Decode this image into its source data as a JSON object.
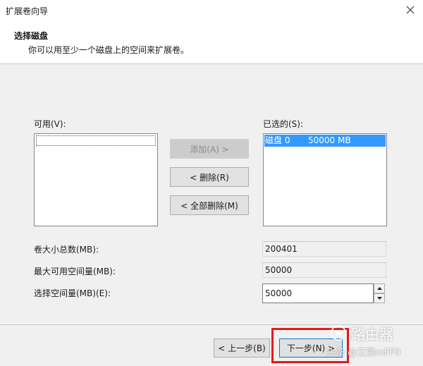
{
  "window": {
    "title": "扩展卷向导"
  },
  "header": {
    "title": "选择磁盘",
    "subtitle": "你可以用至少一个磁盘上的空间来扩展卷。"
  },
  "available": {
    "label": "可用(V):",
    "items": []
  },
  "selected": {
    "label": "已选的(S):",
    "items": [
      {
        "name": "磁盘 0",
        "size": "50000 MB"
      }
    ]
  },
  "buttons": {
    "add": "添加(A) >",
    "remove": "< 删除(R)",
    "remove_all": "< 全部删除(M)",
    "back": "< 上一步(B)",
    "next": "下一步(N) >"
  },
  "fields": {
    "total_label": "卷大小总数(MB):",
    "total_value": "200401",
    "max_label": "最大可用空间量(MB):",
    "max_value": "50000",
    "select_label": "选择空间量(MB)(E):",
    "select_value": "50000"
  },
  "watermark": {
    "brand": "路由器",
    "author": "头条 @艾西mFF0"
  },
  "colors": {
    "selection": "#3399ff",
    "highlight_box": "#e21c1c"
  }
}
